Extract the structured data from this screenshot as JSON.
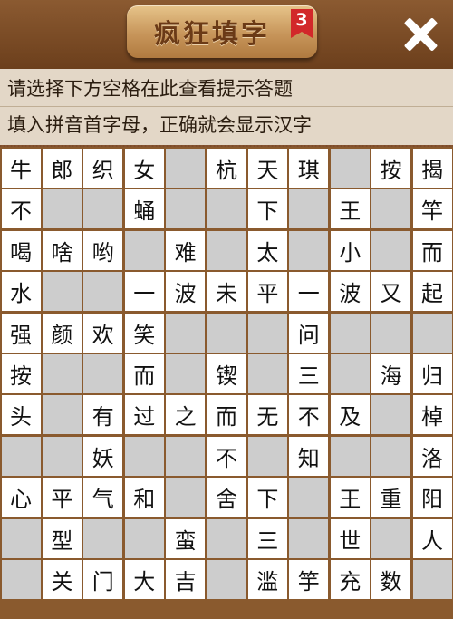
{
  "header": {
    "title": "疯狂填字",
    "level": "3",
    "close_icon": "close-icon"
  },
  "hint": {
    "line1": "请选择下方空格在此查看提示答题",
    "line2": "填入拼音首字母，正确就会显示汉字"
  },
  "colors": {
    "background": "#7a4a24",
    "hint_panel": "#e3d7c7",
    "white_cell": "#ffffff",
    "blank_cell": "#cdcdcd",
    "badge": "#d2282a"
  },
  "grid": {
    "rows": 11,
    "cols": 11,
    "cells": [
      [
        "牛",
        "郎",
        "织",
        "女",
        "",
        "杭",
        "天",
        "琪",
        "",
        "按",
        "揭"
      ],
      [
        "不",
        "",
        "",
        "蛹",
        "",
        "",
        "下",
        "",
        "王",
        "",
        "竿"
      ],
      [
        "喝",
        "啥",
        "哟",
        "",
        "难",
        "",
        "太",
        "",
        "小",
        "",
        "而"
      ],
      [
        "水",
        "",
        "",
        "一",
        "波",
        "未",
        "平",
        "一",
        "波",
        "又",
        "起"
      ],
      [
        "强",
        "颜",
        "欢",
        "笑",
        "",
        "",
        "",
        "问",
        "",
        "",
        ""
      ],
      [
        "按",
        "",
        "",
        "而",
        "",
        "锲",
        "",
        "三",
        "",
        "海",
        "归"
      ],
      [
        "头",
        "",
        "有",
        "过",
        "之",
        "而",
        "无",
        "不",
        "及",
        "",
        "棹"
      ],
      [
        "",
        "",
        "妖",
        "",
        "",
        "不",
        "",
        "知",
        "",
        "",
        "洛"
      ],
      [
        "心",
        "平",
        "气",
        "和",
        "",
        "舍",
        "下",
        "",
        "王",
        "重",
        "阳"
      ],
      [
        "",
        "型",
        "",
        "",
        "蛮",
        "",
        "三",
        "",
        "世",
        "",
        "人"
      ],
      [
        "",
        "关",
        "门",
        "大",
        "吉",
        "",
        "滥",
        "竽",
        "充",
        "数",
        ""
      ]
    ],
    "open": [
      [
        1,
        1,
        1,
        1,
        0,
        1,
        1,
        1,
        0,
        1,
        1
      ],
      [
        1,
        0,
        0,
        1,
        0,
        0,
        1,
        0,
        1,
        0,
        1
      ],
      [
        1,
        1,
        1,
        0,
        1,
        0,
        1,
        0,
        1,
        0,
        1
      ],
      [
        1,
        0,
        0,
        1,
        1,
        1,
        1,
        1,
        1,
        1,
        1
      ],
      [
        1,
        1,
        1,
        1,
        0,
        0,
        0,
        1,
        0,
        0,
        0
      ],
      [
        1,
        0,
        0,
        1,
        0,
        1,
        0,
        1,
        0,
        1,
        1
      ],
      [
        1,
        0,
        1,
        1,
        1,
        1,
        1,
        1,
        1,
        0,
        1
      ],
      [
        0,
        0,
        1,
        0,
        0,
        1,
        0,
        1,
        0,
        0,
        1
      ],
      [
        1,
        1,
        1,
        1,
        0,
        1,
        1,
        0,
        1,
        1,
        1
      ],
      [
        0,
        1,
        0,
        0,
        1,
        0,
        1,
        0,
        1,
        0,
        1
      ],
      [
        0,
        1,
        1,
        1,
        1,
        0,
        1,
        1,
        1,
        1,
        0
      ]
    ]
  }
}
